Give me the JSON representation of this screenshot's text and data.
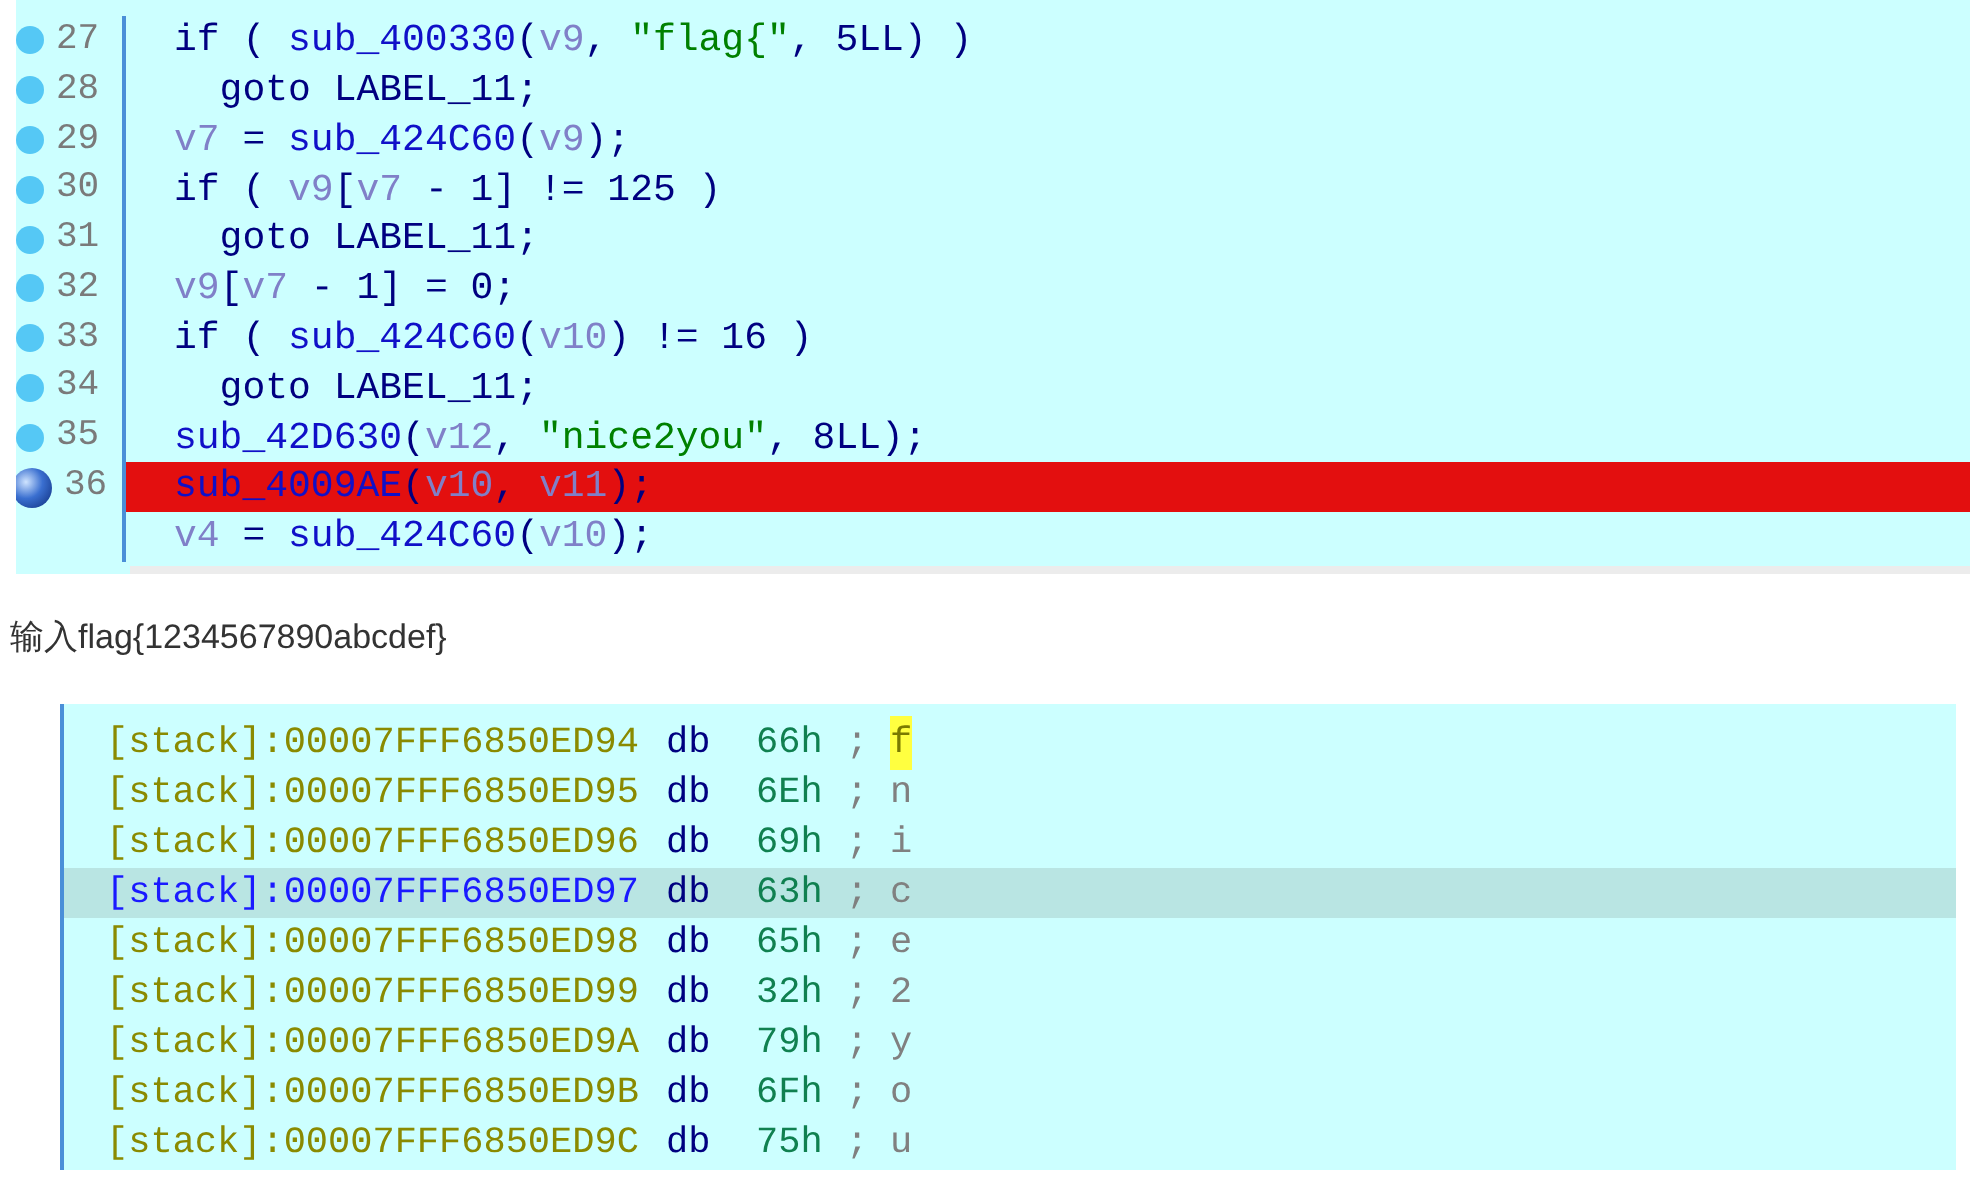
{
  "pseudocode": {
    "lines": [
      {
        "number": "27",
        "breakpoint": false,
        "tokens": [
          {
            "kind": "keyword",
            "text": "if ( "
          },
          {
            "kind": "func",
            "text": "sub_400330"
          },
          {
            "kind": "punct",
            "text": "("
          },
          {
            "kind": "var",
            "text": "v9"
          },
          {
            "kind": "punct",
            "text": ", "
          },
          {
            "kind": "string",
            "text": "\"flag{\""
          },
          {
            "kind": "punct",
            "text": ", 5LL) )"
          }
        ]
      },
      {
        "number": "28",
        "breakpoint": false,
        "tokens": [
          {
            "kind": "keyword",
            "text": "  goto LABEL_11;"
          }
        ]
      },
      {
        "number": "29",
        "breakpoint": false,
        "tokens": [
          {
            "kind": "var",
            "text": "v7"
          },
          {
            "kind": "punct",
            "text": " = "
          },
          {
            "kind": "func",
            "text": "sub_424C60"
          },
          {
            "kind": "punct",
            "text": "("
          },
          {
            "kind": "var",
            "text": "v9"
          },
          {
            "kind": "punct",
            "text": ");"
          }
        ]
      },
      {
        "number": "30",
        "breakpoint": false,
        "tokens": [
          {
            "kind": "keyword",
            "text": "if ( "
          },
          {
            "kind": "var",
            "text": "v9"
          },
          {
            "kind": "punct",
            "text": "["
          },
          {
            "kind": "var",
            "text": "v7"
          },
          {
            "kind": "punct",
            "text": " - 1] != 125 )"
          }
        ]
      },
      {
        "number": "31",
        "breakpoint": false,
        "tokens": [
          {
            "kind": "keyword",
            "text": "  goto LABEL_11;"
          }
        ]
      },
      {
        "number": "32",
        "breakpoint": false,
        "tokens": [
          {
            "kind": "var",
            "text": "v9"
          },
          {
            "kind": "punct",
            "text": "["
          },
          {
            "kind": "var",
            "text": "v7"
          },
          {
            "kind": "punct",
            "text": " - 1] = 0;"
          }
        ]
      },
      {
        "number": "33",
        "breakpoint": false,
        "tokens": [
          {
            "kind": "keyword",
            "text": "if ( "
          },
          {
            "kind": "func",
            "text": "sub_424C60"
          },
          {
            "kind": "punct",
            "text": "("
          },
          {
            "kind": "var",
            "text": "v10"
          },
          {
            "kind": "punct",
            "text": ") != 16 )"
          }
        ]
      },
      {
        "number": "34",
        "breakpoint": false,
        "tokens": [
          {
            "kind": "keyword",
            "text": "  goto LABEL_11;"
          }
        ]
      },
      {
        "number": "35",
        "breakpoint": false,
        "tokens": [
          {
            "kind": "func",
            "text": "sub_42D630"
          },
          {
            "kind": "punct",
            "text": "("
          },
          {
            "kind": "var",
            "text": "v12"
          },
          {
            "kind": "punct",
            "text": ", "
          },
          {
            "kind": "string",
            "text": "\"nice2you\""
          },
          {
            "kind": "punct",
            "text": ", 8LL);"
          }
        ]
      },
      {
        "number": "36",
        "breakpoint": true,
        "tokens": [
          {
            "kind": "func",
            "text": "sub_4009AE"
          },
          {
            "kind": "punct",
            "text": "("
          },
          {
            "kind": "var",
            "text": "v10"
          },
          {
            "kind": "punct",
            "text": ", "
          },
          {
            "kind": "var",
            "text": "v11"
          },
          {
            "kind": "punct",
            "text": ");"
          }
        ]
      },
      {
        "breakpoint": false,
        "tokens": [
          {
            "kind": "var",
            "text": "v4"
          },
          {
            "kind": "punct",
            "text": " = "
          },
          {
            "kind": "func",
            "text": "sub_424C60"
          },
          {
            "kind": "punct",
            "text": "("
          },
          {
            "kind": "var",
            "text": "v10"
          },
          {
            "kind": "punct",
            "text": ");"
          }
        ]
      }
    ]
  },
  "caption": "输入flag{1234567890abcdef}",
  "stack_view": {
    "rows": [
      {
        "address": "[stack]:00007FFF6850ED94",
        "directive": "db",
        "value": "66h",
        "separator": ";",
        "char": "f",
        "selected": false,
        "highlighted": true
      },
      {
        "address": "[stack]:00007FFF6850ED95",
        "directive": "db",
        "value": "6Eh",
        "separator": ";",
        "char": "n",
        "selected": false,
        "highlighted": false
      },
      {
        "address": "[stack]:00007FFF6850ED96",
        "directive": "db",
        "value": "69h",
        "separator": ";",
        "char": "i",
        "selected": false,
        "highlighted": false
      },
      {
        "address": "[stack]:00007FFF6850ED97",
        "directive": "db",
        "value": "63h",
        "separator": ";",
        "char": "c",
        "selected": true,
        "highlighted": false
      },
      {
        "address": "[stack]:00007FFF6850ED98",
        "directive": "db",
        "value": "65h",
        "separator": ";",
        "char": "e",
        "selected": false,
        "highlighted": false
      },
      {
        "address": "[stack]:00007FFF6850ED99",
        "directive": "db",
        "value": "32h",
        "separator": ";",
        "char": "2",
        "selected": false,
        "highlighted": false
      },
      {
        "address": "[stack]:00007FFF6850ED9A",
        "directive": "db",
        "value": "79h",
        "separator": ";",
        "char": "y",
        "selected": false,
        "highlighted": false
      },
      {
        "address": "[stack]:00007FFF6850ED9B",
        "directive": "db",
        "value": "6Fh",
        "separator": ";",
        "char": "o",
        "selected": false,
        "highlighted": false
      },
      {
        "address": "[stack]:00007FFF6850ED9C",
        "directive": "db",
        "value": "75h",
        "separator": ";",
        "char": "u",
        "selected": false,
        "highlighted": false
      }
    ]
  }
}
